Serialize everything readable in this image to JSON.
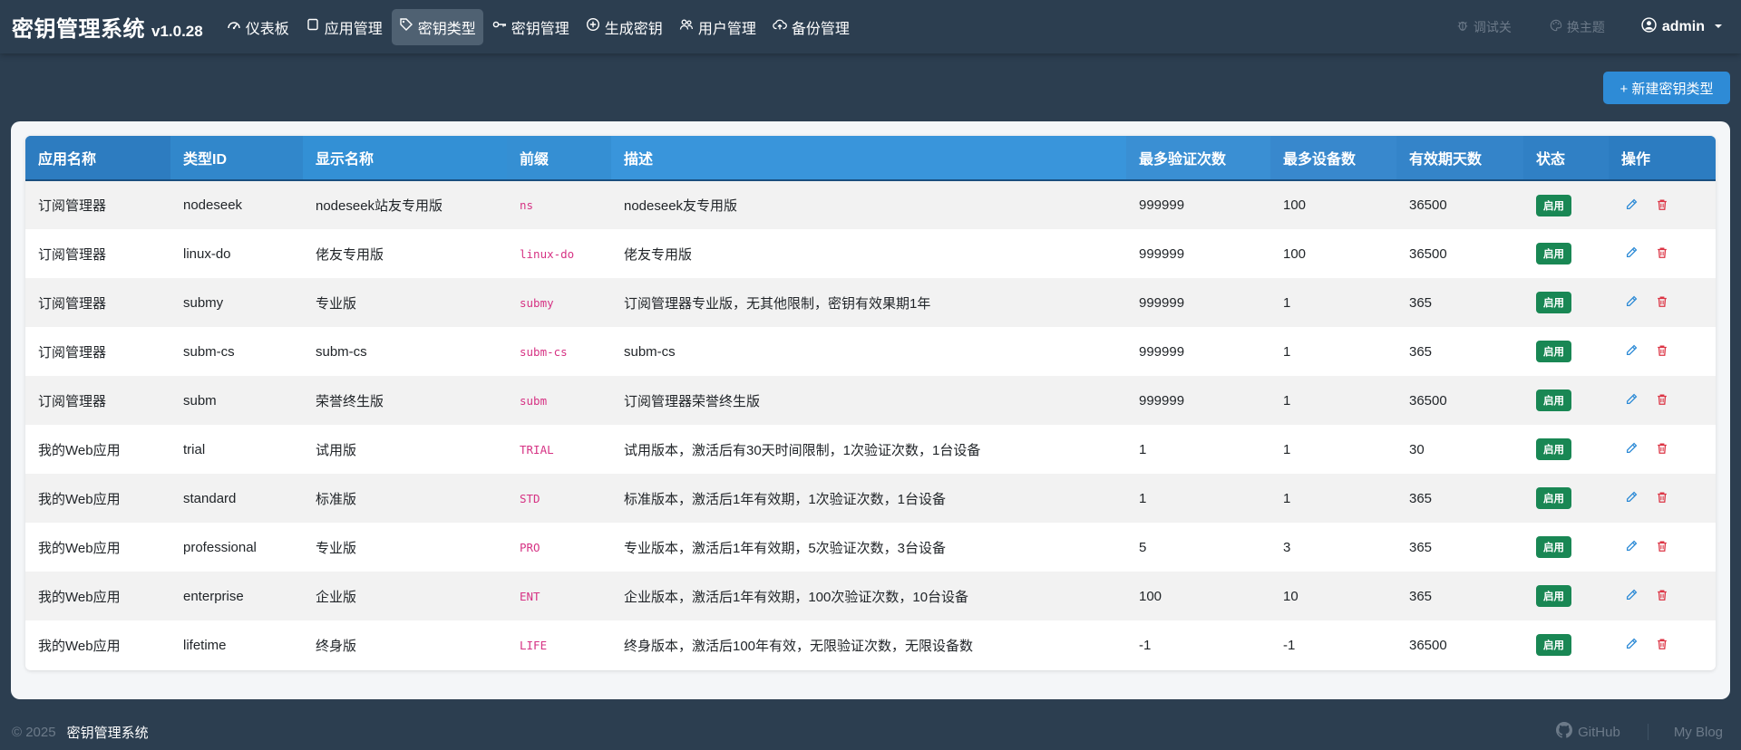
{
  "brand": {
    "name": "密钥管理系统",
    "version": "v1.0.28"
  },
  "nav": [
    {
      "label": "仪表板",
      "icon": "speedometer-icon"
    },
    {
      "label": "应用管理",
      "icon": "square-icon"
    },
    {
      "label": "密钥类型",
      "icon": "tag-icon",
      "active": true
    },
    {
      "label": "密钥管理",
      "icon": "key-icon"
    },
    {
      "label": "生成密钥",
      "icon": "plus-circle-icon"
    },
    {
      "label": "用户管理",
      "icon": "users-icon"
    },
    {
      "label": "备份管理",
      "icon": "cloud-upload-icon"
    }
  ],
  "right_nav": {
    "debug": "调试关",
    "theme": "换主题",
    "user": "admin"
  },
  "toolbar": {
    "new_button": "+ 新建密钥类型"
  },
  "table": {
    "headers": [
      "应用名称",
      "类型ID",
      "显示名称",
      "前缀",
      "描述",
      "最多验证次数",
      "最多设备数",
      "有效期天数",
      "状态",
      "操作"
    ],
    "rows": [
      {
        "app": "订阅管理器",
        "type_id": "nodeseek",
        "display": "nodeseek站友专用版",
        "prefix": "ns",
        "desc": "nodeseek友专用版",
        "max_verify": "999999",
        "max_devices": "100",
        "days": "36500",
        "status": "启用"
      },
      {
        "app": "订阅管理器",
        "type_id": "linux-do",
        "display": "佬友专用版",
        "prefix": "linux-do",
        "desc": "佬友专用版",
        "max_verify": "999999",
        "max_devices": "100",
        "days": "36500",
        "status": "启用"
      },
      {
        "app": "订阅管理器",
        "type_id": "submy",
        "display": "专业版",
        "prefix": "submy",
        "desc": "订阅管理器专业版，无其他限制，密钥有效果期1年",
        "max_verify": "999999",
        "max_devices": "1",
        "days": "365",
        "status": "启用"
      },
      {
        "app": "订阅管理器",
        "type_id": "subm-cs",
        "display": "subm-cs",
        "prefix": "subm-cs",
        "desc": "subm-cs",
        "max_verify": "999999",
        "max_devices": "1",
        "days": "365",
        "status": "启用"
      },
      {
        "app": "订阅管理器",
        "type_id": "subm",
        "display": "荣誉终生版",
        "prefix": "subm",
        "desc": "订阅管理器荣誉终生版",
        "max_verify": "999999",
        "max_devices": "1",
        "days": "36500",
        "status": "启用"
      },
      {
        "app": "我的Web应用",
        "type_id": "trial",
        "display": "试用版",
        "prefix": "TRIAL",
        "desc": "试用版本，激活后有30天时间限制，1次验证次数，1台设备",
        "max_verify": "1",
        "max_devices": "1",
        "days": "30",
        "status": "启用"
      },
      {
        "app": "我的Web应用",
        "type_id": "standard",
        "display": "标准版",
        "prefix": "STD",
        "desc": "标准版本，激活后1年有效期，1次验证次数，1台设备",
        "max_verify": "1",
        "max_devices": "1",
        "days": "365",
        "status": "启用"
      },
      {
        "app": "我的Web应用",
        "type_id": "professional",
        "display": "专业版",
        "prefix": "PRO",
        "desc": "专业版本，激活后1年有效期，5次验证次数，3台设备",
        "max_verify": "5",
        "max_devices": "3",
        "days": "365",
        "status": "启用"
      },
      {
        "app": "我的Web应用",
        "type_id": "enterprise",
        "display": "企业版",
        "prefix": "ENT",
        "desc": "企业版本，激活后1年有效期，100次验证次数，10台设备",
        "max_verify": "100",
        "max_devices": "10",
        "days": "365",
        "status": "启用"
      },
      {
        "app": "我的Web应用",
        "type_id": "lifetime",
        "display": "终身版",
        "prefix": "LIFE",
        "desc": "终身版本，激活后100年有效，无限验证次数，无限设备数",
        "max_verify": "-1",
        "max_devices": "-1",
        "days": "36500",
        "status": "启用"
      }
    ]
  },
  "footer": {
    "copyright": "© 2025",
    "name": "密钥管理系统",
    "github": "GitHub",
    "blog": "My Blog"
  },
  "colors": {
    "navbar": "#2c3e50",
    "primary": "#2e8bd6",
    "success": "#198754",
    "danger": "#dc3545",
    "prefix": "#d63384"
  }
}
